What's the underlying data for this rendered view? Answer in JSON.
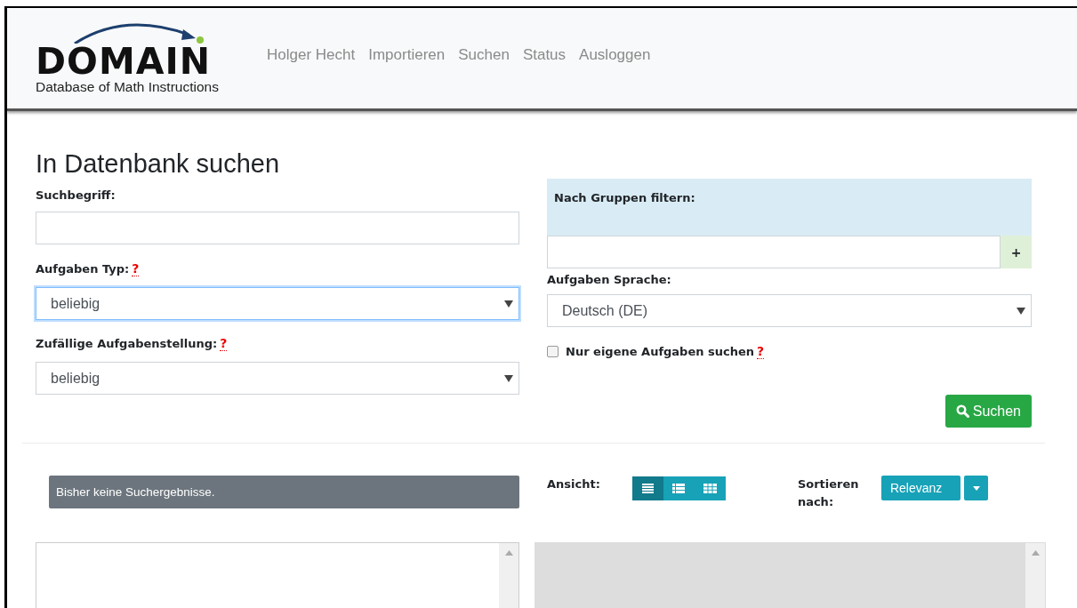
{
  "header": {
    "logo": {
      "word": "DOMAIN",
      "subtitle": "Database of Math Instructions"
    },
    "nav": [
      "Holger Hecht",
      "Importieren",
      "Suchen",
      "Status",
      "Ausloggen"
    ]
  },
  "title": "In Datenbank suchen",
  "left": {
    "search_term": {
      "label": "Suchbegriff:"
    },
    "task_type": {
      "label": "Aufgaben Typ:",
      "help": "?",
      "value": "beliebig",
      "focused": true
    },
    "random": {
      "label": "Zufällige Aufgabenstellung:",
      "help": "?",
      "value": "beliebig",
      "focused": false
    }
  },
  "right": {
    "group_filter": {
      "label": "Nach Gruppen filtern:",
      "add": "+"
    },
    "language": {
      "label": "Aufgaben Sprache:",
      "value": "Deutsch (DE)",
      "focused": false
    },
    "own_only": {
      "label": "Nur eigene Aufgaben suchen",
      "help": "?",
      "checked": false
    },
    "search_button": "Suchen"
  },
  "results": {
    "message": "Bisher keine Suchergebnisse.",
    "view": {
      "label": "Ansicht:",
      "options": [
        {
          "kind": "full",
          "selected": true
        },
        {
          "kind": "list",
          "selected": false
        },
        {
          "kind": "grid",
          "selected": false
        }
      ]
    },
    "sort": {
      "label": "Sortieren nach:",
      "value": "Relevanz"
    }
  }
}
